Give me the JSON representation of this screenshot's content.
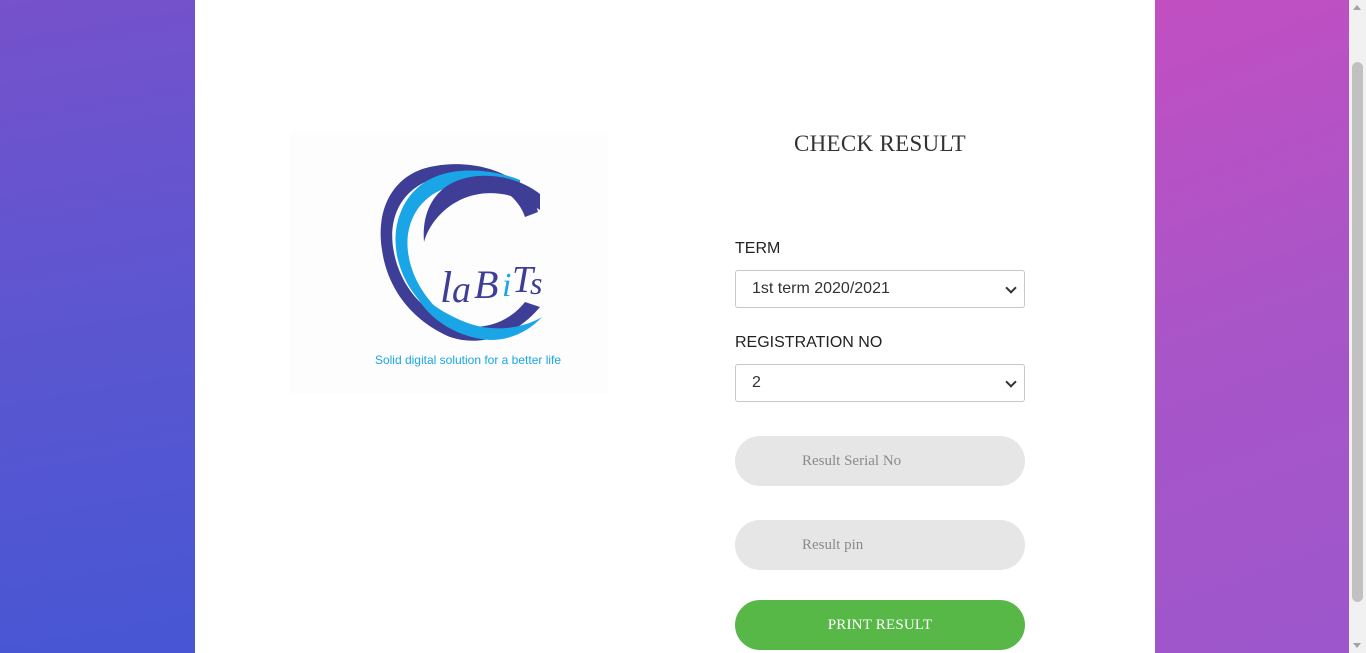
{
  "logo": {
    "brand": "LaBiTs",
    "tagline": "Solid digital solution for a better life"
  },
  "form": {
    "title": "CHECK RESULT",
    "term_label": "TERM",
    "term_value": "1st term 2020/2021",
    "reg_label": "REGISTRATION NO",
    "reg_value": "2",
    "serial_placeholder": "Result Serial No",
    "pin_placeholder": "Result pin",
    "submit_label": "PRINT RESULT"
  },
  "colors": {
    "accent_green": "#57b847",
    "logo_navy": "#3f3e96",
    "logo_cyan": "#1aa6e6"
  },
  "icons": {
    "select_arrow": "chevron-down-icon"
  }
}
